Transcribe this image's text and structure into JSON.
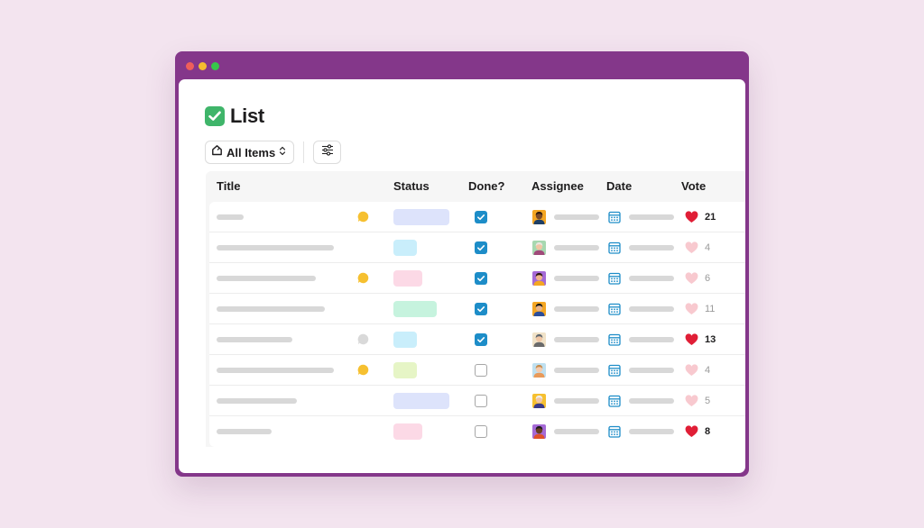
{
  "header": {
    "title": "List"
  },
  "toolbar": {
    "view_label": "All Items"
  },
  "columns": [
    "Title",
    "Status",
    "Done?",
    "Assignee",
    "Date",
    "Vote"
  ],
  "colors": {
    "window": "#84378a",
    "background": "#f3e4ef",
    "checkbox": "#1d8dc8",
    "heart_active": "#e01e36",
    "heart_inactive": "#f8c9cf"
  },
  "rows": [
    {
      "comment": "yellow",
      "status_color": "#dde3fb",
      "done": true,
      "avatar": "avatar-1",
      "vote_active": true,
      "votes": "21"
    },
    {
      "comment": "none",
      "status_color": "#c9eefb",
      "done": true,
      "avatar": "avatar-2",
      "vote_active": false,
      "votes": "4"
    },
    {
      "comment": "yellow",
      "status_color": "#fcd9e6",
      "done": true,
      "avatar": "avatar-3",
      "vote_active": false,
      "votes": "6"
    },
    {
      "comment": "none",
      "status_color": "#c6f3de",
      "done": true,
      "avatar": "avatar-4",
      "vote_active": false,
      "votes": "11"
    },
    {
      "comment": "gray",
      "status_color": "#c9eefb",
      "done": true,
      "avatar": "avatar-5",
      "vote_active": true,
      "votes": "13"
    },
    {
      "comment": "yellow",
      "status_color": "#e6f5c6",
      "done": false,
      "avatar": "avatar-6",
      "vote_active": false,
      "votes": "4"
    },
    {
      "comment": "none",
      "status_color": "#dde3fb",
      "done": false,
      "avatar": "avatar-7",
      "vote_active": false,
      "votes": "5"
    },
    {
      "comment": "none",
      "status_color": "#fcd9e6",
      "done": false,
      "avatar": "avatar-8",
      "vote_active": true,
      "votes": "8"
    }
  ]
}
